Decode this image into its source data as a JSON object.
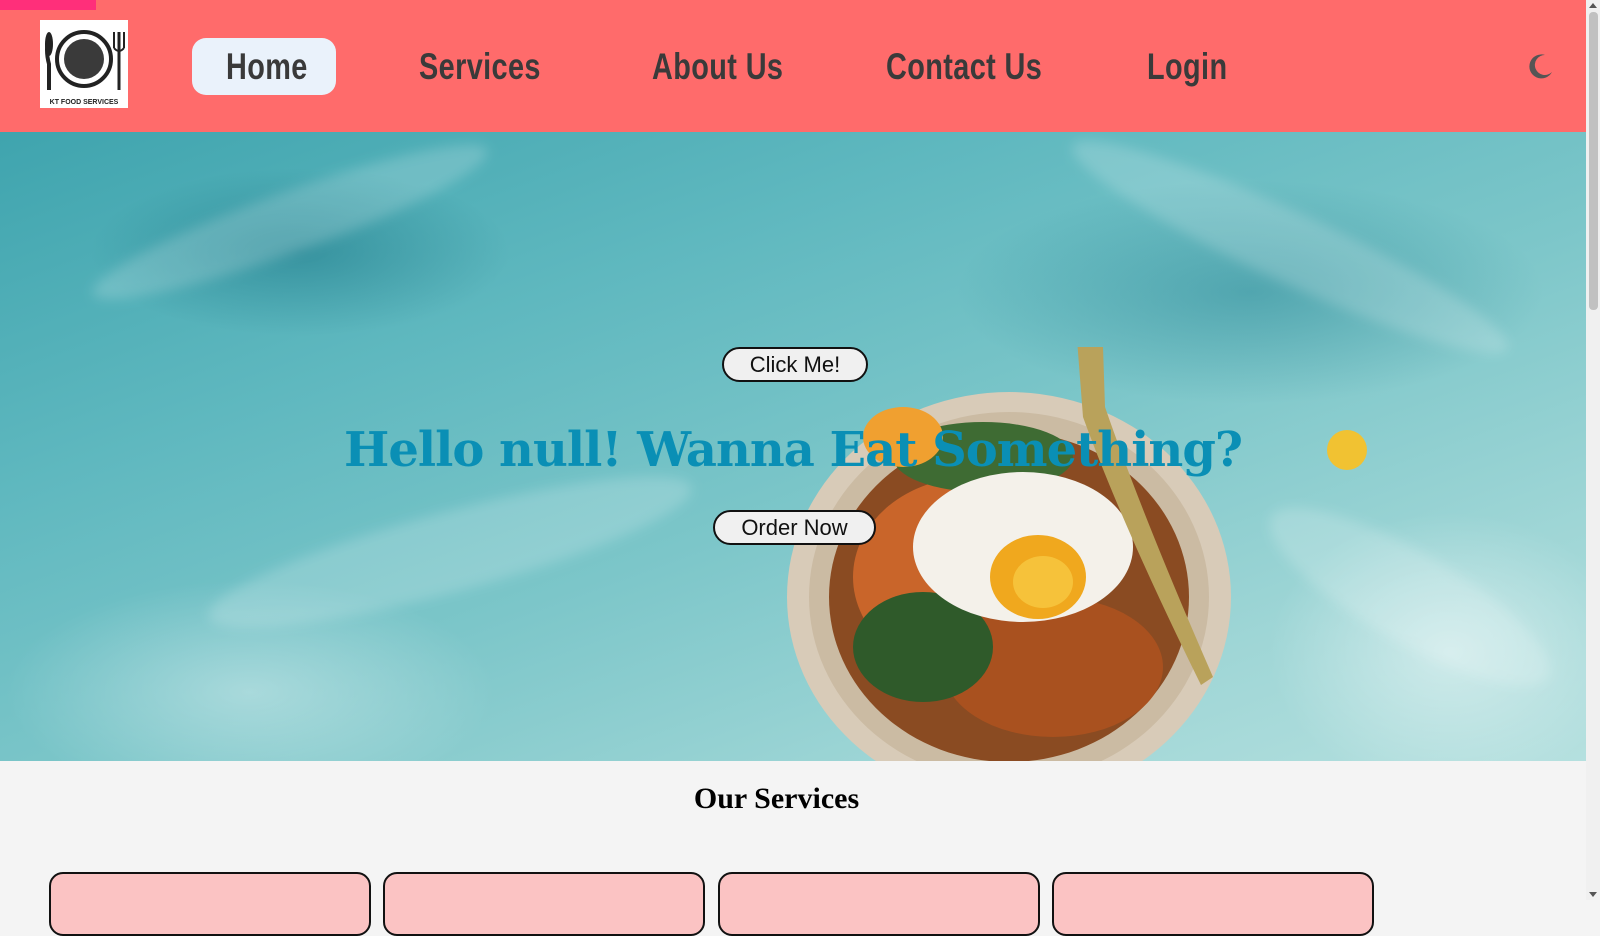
{
  "page_progress_percent": 6,
  "nav": {
    "logo_text": "KT FOOD SERVICES",
    "logo_icon": "plate-fork-knife-icon",
    "items": [
      {
        "label": "Home",
        "active": true
      },
      {
        "label": "Services",
        "active": false
      },
      {
        "label": "About Us",
        "active": false
      },
      {
        "label": "Contact Us",
        "active": false
      },
      {
        "label": "Login",
        "active": false
      }
    ],
    "theme_toggle_icon": "moon-icon"
  },
  "hero": {
    "click_button": "Click Me!",
    "heading": "Hello null! Wanna Eat Something?",
    "order_button": "Order Now"
  },
  "services": {
    "title": "Our Services",
    "cards_count": 4
  },
  "colors": {
    "navbar": "#ff6b6b",
    "progress": "#ff2f7a",
    "hero_heading": "#0a8fb5",
    "card": "#fbc3c3",
    "accent_dot": "#f1c232"
  }
}
